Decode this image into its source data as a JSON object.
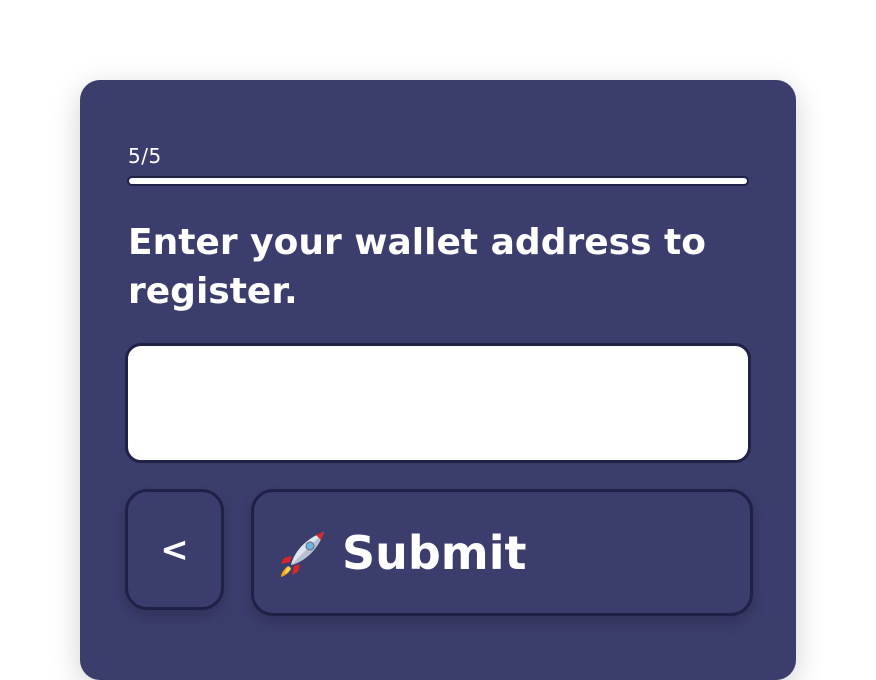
{
  "progress": {
    "label": "5/5",
    "fraction": 1.0
  },
  "question": {
    "heading": "Enter your wallet address to register."
  },
  "wallet_input": {
    "value": "",
    "placeholder": ""
  },
  "nav": {
    "back_label": "<",
    "submit_label": "Submit",
    "submit_icon": "rocket-icon"
  },
  "colors": {
    "card_background": "#3b3d6c",
    "border_dark": "#1f2147",
    "text": "#ffffff",
    "input_background": "#ffffff"
  }
}
